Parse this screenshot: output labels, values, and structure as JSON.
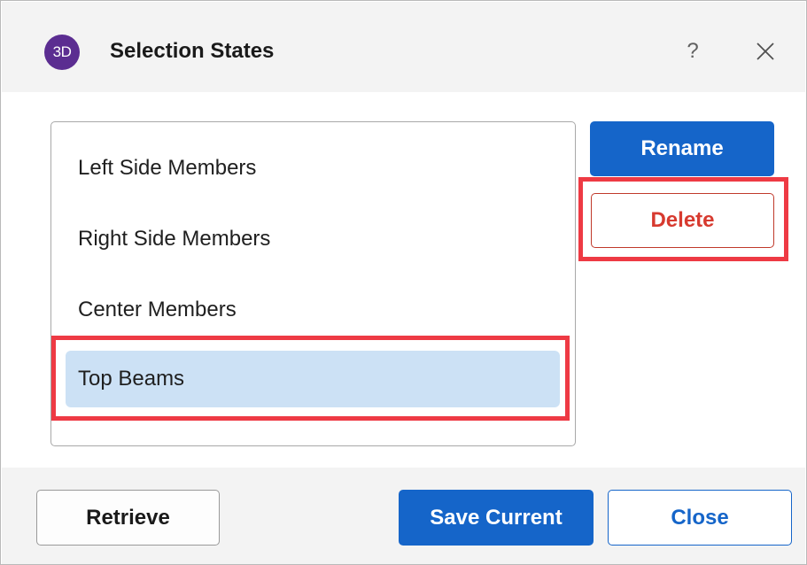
{
  "app": {
    "icon_text": "3D",
    "title": "Selection States",
    "help_glyph": "?"
  },
  "list": {
    "items": [
      {
        "label": "Left Side Members",
        "selected": false
      },
      {
        "label": "Right Side Members",
        "selected": false
      },
      {
        "label": "Center Members",
        "selected": false
      },
      {
        "label": "Top Beams",
        "selected": true
      }
    ]
  },
  "actions": {
    "rename_label": "Rename",
    "delete_label": "Delete"
  },
  "footer": {
    "retrieve_label": "Retrieve",
    "save_current_label": "Save Current",
    "close_label": "Close"
  },
  "colors": {
    "primary": "#1565c9",
    "danger": "#d73a2f",
    "highlight": "#ee3a44",
    "selection": "#cce1f5",
    "app_icon": "#5b2d91"
  },
  "icons": {
    "app": "3d-app-icon",
    "help": "help-icon",
    "close": "close-icon"
  }
}
